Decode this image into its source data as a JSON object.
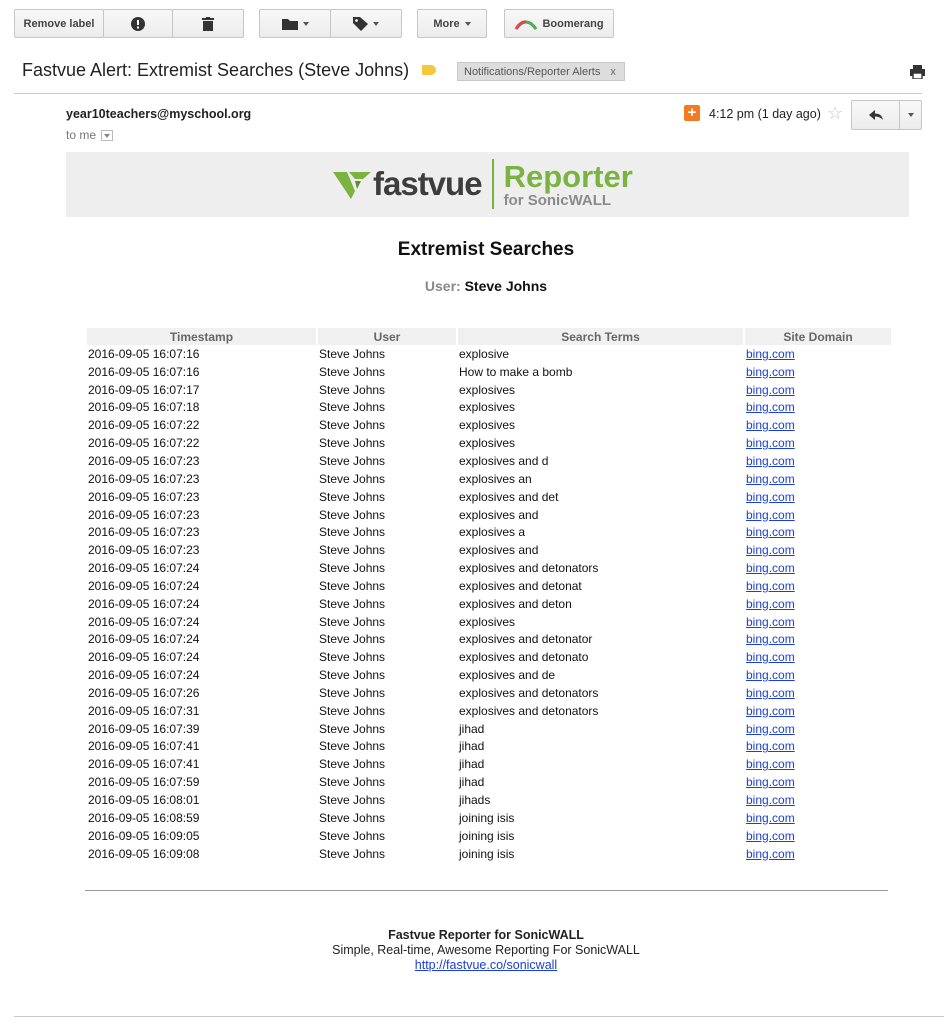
{
  "toolbar": {
    "remove_label": "Remove label",
    "more_label": "More",
    "boomerang_label": "Boomerang"
  },
  "email": {
    "subject": "Fastvue Alert: Extremist Searches (Steve Johns)",
    "label_chip": "Notifications/Reporter Alerts",
    "label_remove": "x",
    "sender": "year10teachers@myschool.org",
    "recipient": "to me",
    "time": "4:12 pm (1 day ago)"
  },
  "banner": {
    "logo_fastvue": "fastvue",
    "logo_reporter": "Reporter",
    "logo_sonicwall": "for SonicWALL"
  },
  "report": {
    "title": "Extremist Searches",
    "user_label": "User:",
    "user_value": "Steve Johns",
    "columns": [
      "Timestamp",
      "User",
      "Search Terms",
      "Site Domain"
    ],
    "rows": [
      [
        "2016-09-05 16:07:16",
        "Steve Johns",
        "explosive",
        "bing.com"
      ],
      [
        "2016-09-05 16:07:16",
        "Steve Johns",
        "How to make a bomb",
        "bing.com"
      ],
      [
        "2016-09-05 16:07:17",
        "Steve Johns",
        "explosives",
        "bing.com"
      ],
      [
        "2016-09-05 16:07:18",
        "Steve Johns",
        "explosives",
        "bing.com"
      ],
      [
        "2016-09-05 16:07:22",
        "Steve Johns",
        "explosives",
        "bing.com"
      ],
      [
        "2016-09-05 16:07:22",
        "Steve Johns",
        "explosives",
        "bing.com"
      ],
      [
        "2016-09-05 16:07:23",
        "Steve Johns",
        "explosives and d",
        "bing.com"
      ],
      [
        "2016-09-05 16:07:23",
        "Steve Johns",
        "explosives an",
        "bing.com"
      ],
      [
        "2016-09-05 16:07:23",
        "Steve Johns",
        "explosives and det",
        "bing.com"
      ],
      [
        "2016-09-05 16:07:23",
        "Steve Johns",
        "explosives and",
        "bing.com"
      ],
      [
        "2016-09-05 16:07:23",
        "Steve Johns",
        "explosives a",
        "bing.com"
      ],
      [
        "2016-09-05 16:07:23",
        "Steve Johns",
        "explosives and",
        "bing.com"
      ],
      [
        "2016-09-05 16:07:24",
        "Steve Johns",
        "explosives and detonators",
        "bing.com"
      ],
      [
        "2016-09-05 16:07:24",
        "Steve Johns",
        "explosives and detonat",
        "bing.com"
      ],
      [
        "2016-09-05 16:07:24",
        "Steve Johns",
        "explosives and deton",
        "bing.com"
      ],
      [
        "2016-09-05 16:07:24",
        "Steve Johns",
        "explosives",
        "bing.com"
      ],
      [
        "2016-09-05 16:07:24",
        "Steve Johns",
        "explosives and detonator",
        "bing.com"
      ],
      [
        "2016-09-05 16:07:24",
        "Steve Johns",
        "explosives and detonato",
        "bing.com"
      ],
      [
        "2016-09-05 16:07:24",
        "Steve Johns",
        "explosives and de",
        "bing.com"
      ],
      [
        "2016-09-05 16:07:26",
        "Steve Johns",
        "explosives and detonators",
        "bing.com"
      ],
      [
        "2016-09-05 16:07:31",
        "Steve Johns",
        "explosives and detonators",
        "bing.com"
      ],
      [
        "2016-09-05 16:07:39",
        "Steve Johns",
        "jihad",
        "bing.com"
      ],
      [
        "2016-09-05 16:07:41",
        "Steve Johns",
        "jihad",
        "bing.com"
      ],
      [
        "2016-09-05 16:07:41",
        "Steve Johns",
        "jihad",
        "bing.com"
      ],
      [
        "2016-09-05 16:07:59",
        "Steve Johns",
        "jihad",
        "bing.com"
      ],
      [
        "2016-09-05 16:08:01",
        "Steve Johns",
        "jihads",
        "bing.com"
      ],
      [
        "2016-09-05 16:08:59",
        "Steve Johns",
        "joining isis",
        "bing.com"
      ],
      [
        "2016-09-05 16:09:05",
        "Steve Johns",
        "joining isis",
        "bing.com"
      ],
      [
        "2016-09-05 16:09:08",
        "Steve Johns",
        "joining isis",
        "bing.com"
      ]
    ]
  },
  "footer": {
    "name": "Fastvue Reporter for SonicWALL",
    "tagline": "Simple, Real-time, Awesome Reporting For SonicWALL",
    "link": "http://fastvue.co/sonicwall"
  },
  "colors": {
    "label_tag": "#f5c73a",
    "fastvue_green": "#7ab340",
    "link_blue": "#1a3fd4",
    "add_orange": "#f27b22"
  }
}
